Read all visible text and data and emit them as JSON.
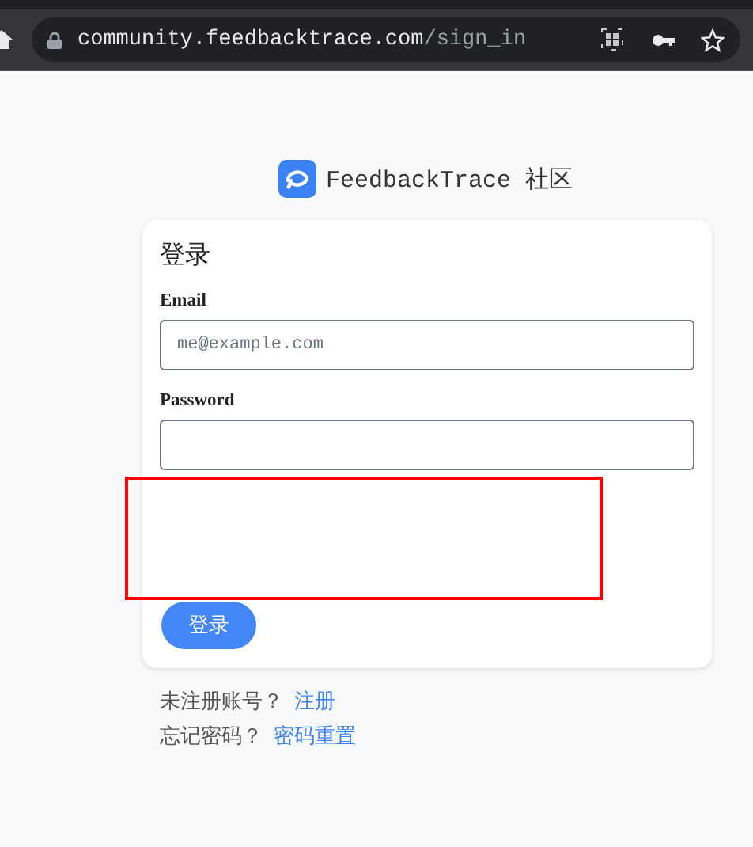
{
  "browser": {
    "url_host": "community.feedbacktrace.com",
    "url_path": "/sign_in"
  },
  "brand": {
    "name": "FeedbackTrace 社区"
  },
  "card": {
    "title": "登录",
    "fields": [
      {
        "label": "Email",
        "placeholder": "me@example.com"
      },
      {
        "label": "Password"
      }
    ],
    "submit": "登录"
  },
  "links": [
    {
      "prompt": "未注册账号？",
      "link": "注册"
    },
    {
      "prompt": "忘记密码？",
      "link": "密码重置"
    }
  ]
}
